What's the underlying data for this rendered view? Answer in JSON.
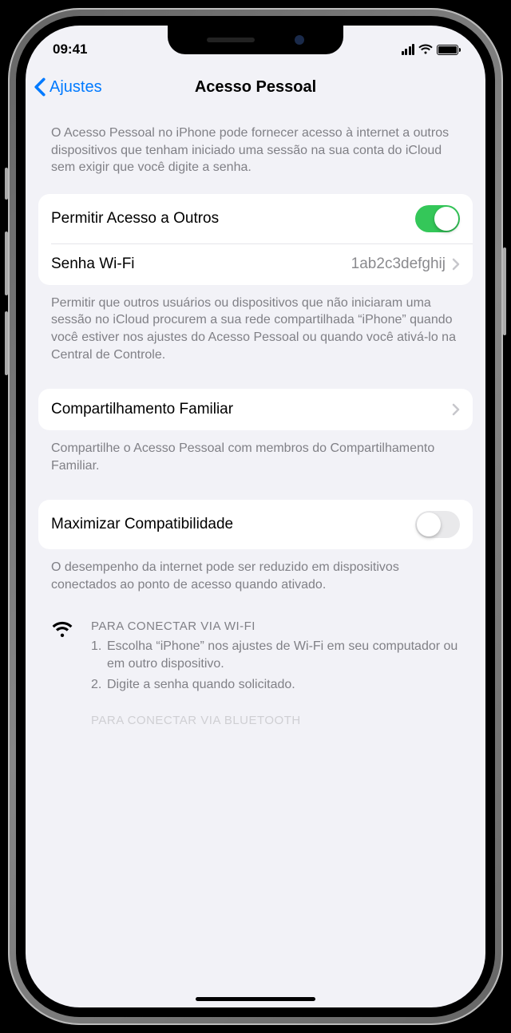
{
  "statusbar": {
    "time": "09:41"
  },
  "nav": {
    "back": "Ajustes",
    "title": "Acesso Pessoal"
  },
  "intro": "O Acesso Pessoal no iPhone pode fornecer acesso à internet a outros dispositivos que tenham iniciado uma sessão na sua conta do iCloud sem exigir que você digite a senha.",
  "group1": {
    "allow_label": "Permitir Acesso a Outros",
    "wifi_label": "Senha Wi-Fi",
    "wifi_value": "1ab2c3defghij"
  },
  "footer1": "Permitir que outros usuários ou dispositivos que não iniciaram uma sessão no iCloud procurem a sua rede compartilhada “iPhone” quando você estiver nos ajustes do Acesso Pessoal ou quando você ativá-lo na Central de Controle.",
  "group2": {
    "family_label": "Compartilhamento Familiar"
  },
  "footer2": "Compartilhe o Acesso Pessoal com membros do Compartilhamento Familiar.",
  "group3": {
    "maxcompat_label": "Maximizar Compatibilidade"
  },
  "footer3": "O desempenho da internet pode ser reduzido em dispositivos conectados ao ponto de acesso quando ativado.",
  "help_wifi": {
    "title": "PARA CONECTAR VIA WI-FI",
    "step1": "Escolha “iPhone” nos ajustes de Wi-Fi em seu computador ou em outro dispositivo.",
    "step2": "Digite a senha quando solicitado."
  },
  "help_bt": {
    "title": "PARA CONECTAR VIA BLUETOOTH"
  }
}
